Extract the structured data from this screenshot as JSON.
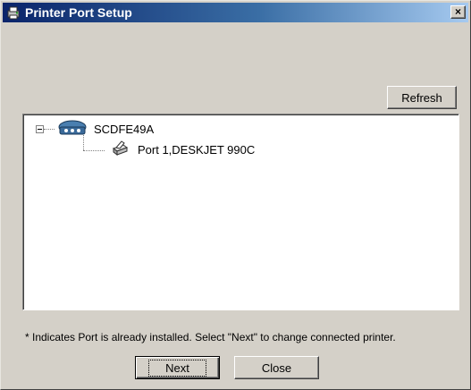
{
  "window": {
    "title": "Printer Port Setup",
    "close_glyph": "×",
    "title_icon": "printer-setup-icon"
  },
  "toolbar": {
    "refresh_label": "Refresh"
  },
  "tree": {
    "root": {
      "label": "SCDFE49A",
      "icon": "print-server-icon",
      "expanded": true
    },
    "children": [
      {
        "label": "Port 1,DESKJET 990C",
        "icon": "printer-icon"
      }
    ]
  },
  "footer": {
    "note": "* Indicates Port is already installed. Select \"Next\" to change connected printer.",
    "next_label": "Next",
    "close_label": "Close"
  },
  "colors": {
    "titlebar_start": "#0a246a",
    "titlebar_end": "#a6caf0",
    "dialog_bg": "#d4d0c8"
  }
}
